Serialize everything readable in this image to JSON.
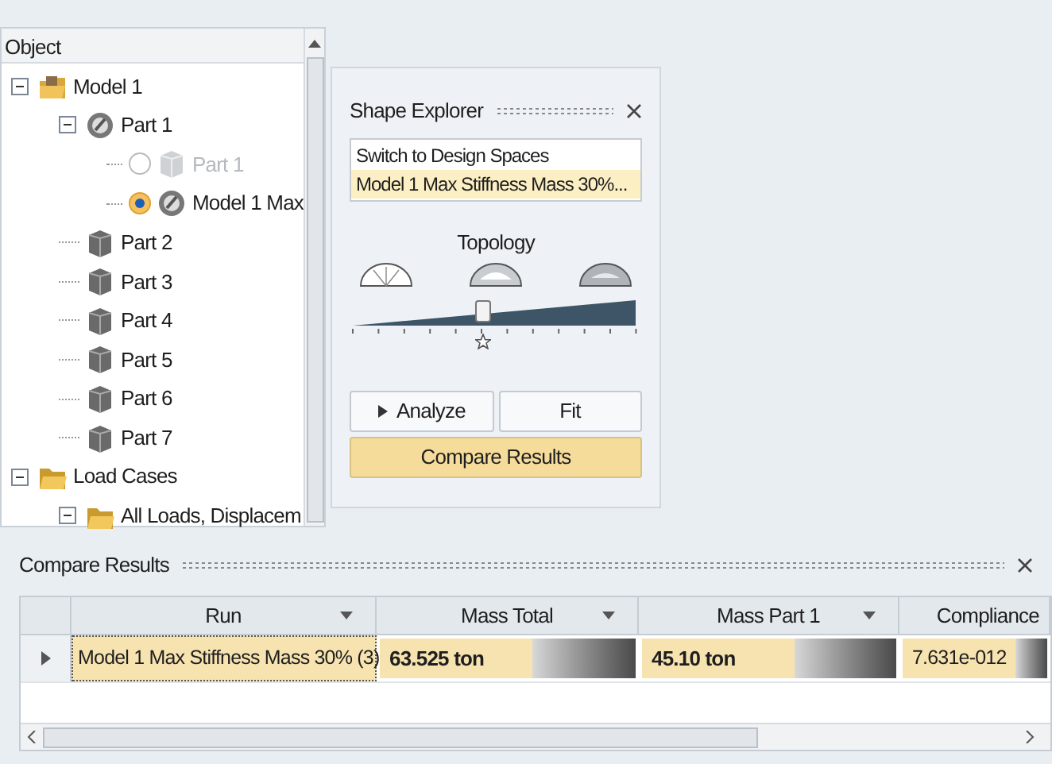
{
  "tree": {
    "header": "Object",
    "items": [
      {
        "label": "Model 1",
        "kind": "model",
        "expanded": true,
        "children": [
          {
            "label": "Part 1",
            "kind": "design",
            "expanded": true,
            "children": [
              {
                "label": "Part 1",
                "kind": "part",
                "selected": false,
                "disabled": true
              },
              {
                "label": "Model 1 Max",
                "kind": "design",
                "selected": true,
                "disabled": false
              }
            ]
          },
          {
            "label": "Part 2",
            "kind": "part"
          },
          {
            "label": "Part 3",
            "kind": "part"
          },
          {
            "label": "Part 4",
            "kind": "part"
          },
          {
            "label": "Part 5",
            "kind": "part"
          },
          {
            "label": "Part 6",
            "kind": "part"
          },
          {
            "label": "Part 7",
            "kind": "part"
          }
        ]
      },
      {
        "label": "Load Cases",
        "kind": "folder",
        "expanded": true,
        "children": [
          {
            "label": "All Loads, Displacem",
            "kind": "folder",
            "expanded": true
          }
        ]
      }
    ]
  },
  "shape_explorer": {
    "title": "Shape Explorer",
    "list": [
      {
        "label": "Switch to Design Spaces",
        "selected": false
      },
      {
        "label": "Model 1 Max Stiffness Mass 30%...",
        "selected": true
      }
    ],
    "topology_label": "Topology",
    "slider": {
      "level": 0.46
    },
    "buttons": [
      {
        "label": "Analyze",
        "kind": "play"
      },
      {
        "label": "Fit",
        "kind": "plain"
      }
    ],
    "compare_button": "Compare Results"
  },
  "compare_results": {
    "title": "Compare Results",
    "columns": [
      "Run",
      "Mass Total",
      "Mass Part 1",
      "Compliance"
    ],
    "rows": [
      {
        "cells": [
          "Model 1 Max Stiffness Mass 30% (3)",
          "63.525 ton",
          "45.10 ton",
          "7.631e-012"
        ]
      }
    ]
  }
}
